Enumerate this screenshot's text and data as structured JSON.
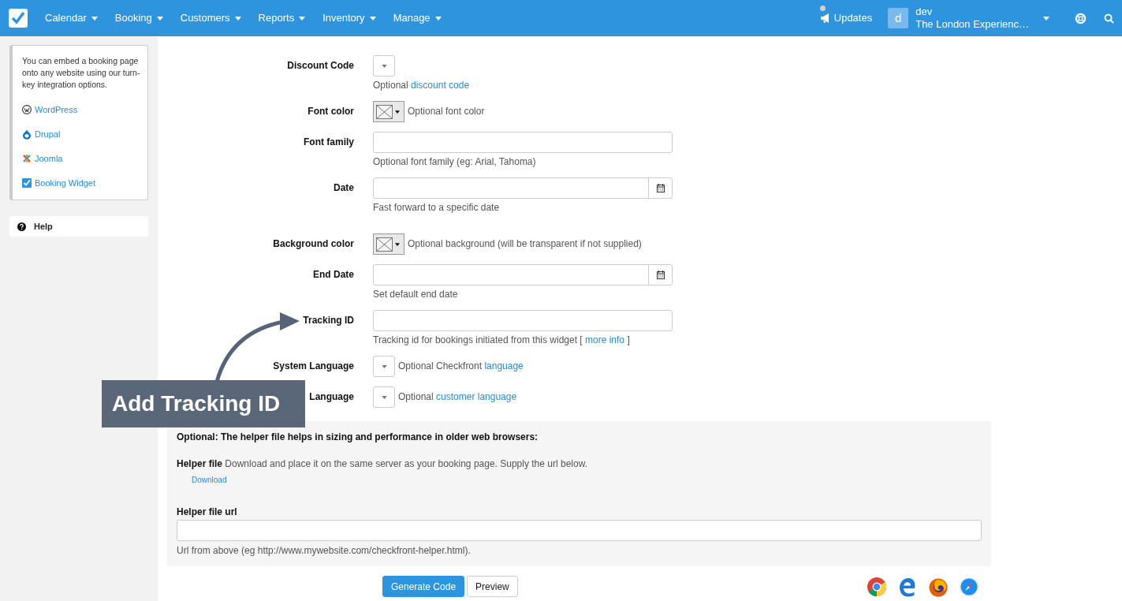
{
  "nav": {
    "menus": [
      "Calendar",
      "Booking",
      "Customers",
      "Reports",
      "Inventory",
      "Manage"
    ],
    "updates": "Updates",
    "avatar": "d",
    "user": "dev",
    "account": "The London Experienc…"
  },
  "sidebar": {
    "intro": "You can embed a booking page onto any website using our turn-key integration options.",
    "links": [
      {
        "label": "WordPress",
        "kind": "wordpress"
      },
      {
        "label": "Drupal",
        "kind": "drupal"
      },
      {
        "label": "Joomla",
        "kind": "joomla"
      },
      {
        "label": "Booking Widget",
        "kind": "widget"
      }
    ],
    "help": "Help"
  },
  "form": [
    {
      "label": "Discount Code",
      "kind": "select",
      "help": [
        {
          "text": "Optional "
        },
        {
          "link": "discount code"
        }
      ]
    },
    {
      "label": "Font color",
      "kind": "color",
      "hint": "Optional font color"
    },
    {
      "label": "Font family",
      "kind": "text",
      "help": [
        {
          "text": "Optional font family (eg: Arial, Tahoma)"
        }
      ]
    },
    {
      "label": "Date",
      "kind": "date",
      "help": [
        {
          "text": "Fast forward to a specific date"
        }
      ]
    },
    {
      "label": "Background color",
      "kind": "color",
      "hint": "Optional background (will be transparent if not supplied)",
      "spaced": true
    },
    {
      "label": "End Date",
      "kind": "date",
      "help": [
        {
          "text": "Set default end date"
        }
      ]
    },
    {
      "label": "Tracking ID",
      "kind": "text",
      "help": [
        {
          "text": "Tracking id for bookings initiated from this widget [ "
        },
        {
          "link": "more info"
        },
        {
          "text": " ]"
        }
      ]
    },
    {
      "label": "System Language",
      "kind": "select",
      "hint_parts": [
        {
          "text": "Optional Checkfront "
        },
        {
          "link": "language"
        }
      ]
    },
    {
      "label": "Language",
      "kind": "select",
      "hint_parts": [
        {
          "text": "Optional "
        },
        {
          "link": "customer language"
        }
      ]
    }
  ],
  "helper": {
    "heading": "Optional: The helper file helps in sizing and performance in older web browsers:",
    "file_label": "Helper file",
    "file_text": "Download and place it on the same server as your booking page. Supply the url below.",
    "download": "Download",
    "url_label": "Helper file url",
    "url_help": "Url from above (eg http://www.mywebsite.com/checkfront-helper.html)."
  },
  "buttons": [
    {
      "label": "Generate Code",
      "kind": "primary"
    },
    {
      "label": "Preview",
      "kind": "default"
    }
  ],
  "browsers": [
    {
      "kind": "chrome"
    },
    {
      "kind": "edge"
    },
    {
      "kind": "firefox"
    },
    {
      "kind": "safari"
    }
  ],
  "callout": {
    "text": "Add Tracking ID"
  }
}
